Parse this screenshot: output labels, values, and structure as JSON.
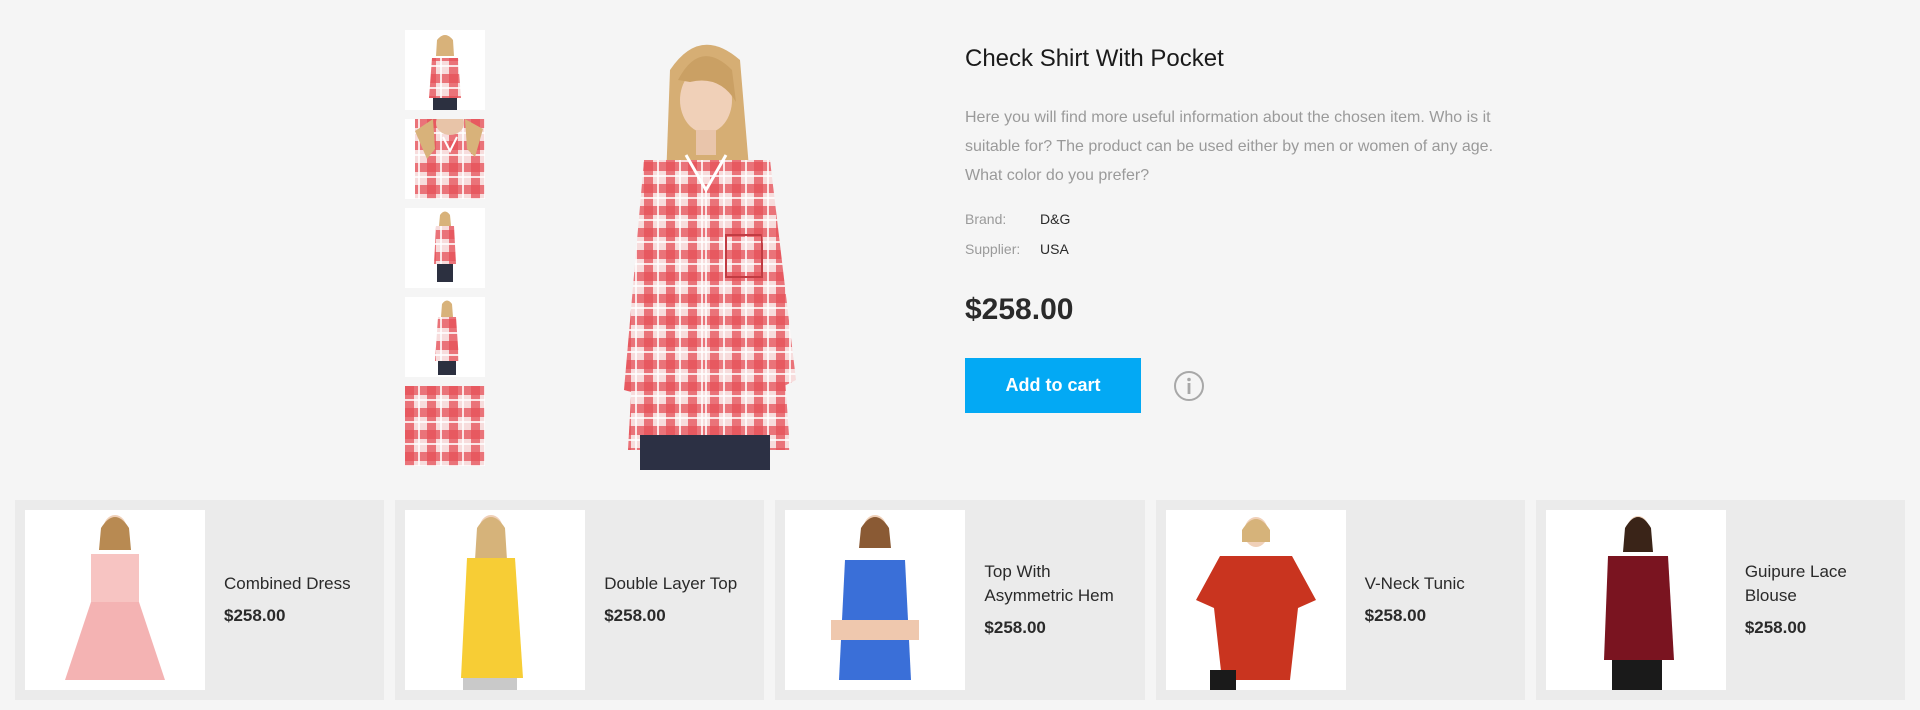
{
  "product": {
    "title": "Check Shirt With Pocket",
    "description": "Here you will find more useful information about the chosen item. Who is it suitable for? The product can be used either by men or women of any age. What color do you prefer?",
    "brand_label": "Brand:",
    "brand_value": "D&G",
    "supplier_label": "Supplier:",
    "supplier_value": "USA",
    "price": "$258.00",
    "add_to_cart": "Add to cart",
    "thumbnails": [
      "front view",
      "collar closeup",
      "full length",
      "side view",
      "fabric detail"
    ]
  },
  "related": [
    {
      "name": "Combined Dress",
      "price": "$258.00",
      "color": "#f4b3b3"
    },
    {
      "name": "Double Layer Top",
      "price": "$258.00",
      "color": "#f7cd35"
    },
    {
      "name": "Top With Asymmetric Hem",
      "price": "$258.00",
      "color": "#3a6fd8"
    },
    {
      "name": "V-Neck Tunic",
      "price": "$258.00",
      "color": "#c9341f"
    },
    {
      "name": "Guipure Lace Blouse",
      "price": "$258.00",
      "color": "#7a1420"
    }
  ],
  "colors": {
    "accent": "#03a9f4",
    "plaid": "#e8464c"
  }
}
